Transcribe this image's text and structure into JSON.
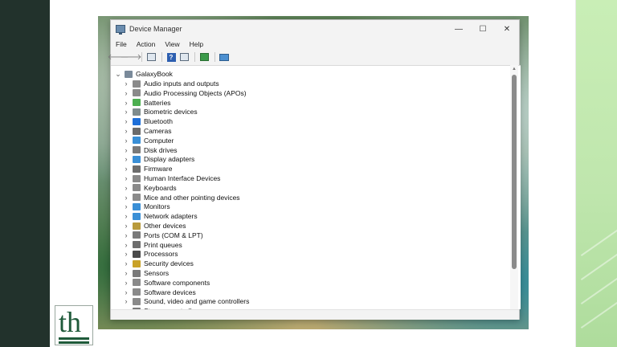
{
  "window": {
    "title": "Device Manager",
    "controls": {
      "minimize": "—",
      "maximize": "☐",
      "close": "✕"
    }
  },
  "menu": [
    "File",
    "Action",
    "View",
    "Help"
  ],
  "toolbar": {
    "help_glyph": "?"
  },
  "tree": {
    "root": "GalaxyBook",
    "items": [
      {
        "label": "Audio inputs and outputs",
        "color": "#8a8a8a"
      },
      {
        "label": "Audio Processing Objects (APOs)",
        "color": "#8a8a8a"
      },
      {
        "label": "Batteries",
        "color": "#4caf50"
      },
      {
        "label": "Biometric devices",
        "color": "#7f8c8d"
      },
      {
        "label": "Bluetooth",
        "color": "#1e6fd9"
      },
      {
        "label": "Cameras",
        "color": "#6b6b6b"
      },
      {
        "label": "Computer",
        "color": "#3a8fd6"
      },
      {
        "label": "Disk drives",
        "color": "#7a7a7a"
      },
      {
        "label": "Display adapters",
        "color": "#3a8fd6"
      },
      {
        "label": "Firmware",
        "color": "#6d6d6d"
      },
      {
        "label": "Human Interface Devices",
        "color": "#8a8a8a"
      },
      {
        "label": "Keyboards",
        "color": "#8a8a8a"
      },
      {
        "label": "Mice and other pointing devices",
        "color": "#8a8a8a"
      },
      {
        "label": "Monitors",
        "color": "#3a8fd6"
      },
      {
        "label": "Network adapters",
        "color": "#3a8fd6"
      },
      {
        "label": "Other devices",
        "color": "#b89a3c"
      },
      {
        "label": "Ports (COM & LPT)",
        "color": "#7a7a7a"
      },
      {
        "label": "Print queues",
        "color": "#6d6d6d"
      },
      {
        "label": "Processors",
        "color": "#4a4a4a"
      },
      {
        "label": "Security devices",
        "color": "#c9a227"
      },
      {
        "label": "Sensors",
        "color": "#7a7a7a"
      },
      {
        "label": "Software components",
        "color": "#8a8a8a"
      },
      {
        "label": "Software devices",
        "color": "#8a8a8a"
      },
      {
        "label": "Sound, video and game controllers",
        "color": "#8a8a8a"
      },
      {
        "label": "Storage controllers",
        "color": "#7a7a7a"
      }
    ]
  },
  "glyphs": {
    "expanded": "⌄",
    "collapsed": "›",
    "scroll_up": "▲"
  },
  "logo": {
    "letters": "th"
  }
}
